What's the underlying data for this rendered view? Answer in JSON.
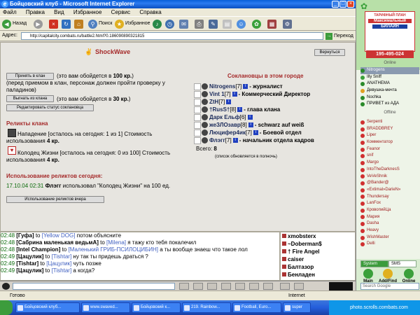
{
  "window": {
    "title": "Бойцовский клуб - Microsoft Internet Explorer"
  },
  "menu": [
    "Файл",
    "Правка",
    "Вид",
    "Избранное",
    "Сервис",
    "Справка"
  ],
  "toolbar": {
    "back_label": "Назад",
    "search_label": "Поиск",
    "favorites_label": "Избранное"
  },
  "address": {
    "label": "Адрес:",
    "url": "http://capitalcity.combats.ru/battle2.html?0.186090890321815",
    "go_label": "Переход"
  },
  "page": {
    "clan_name": "ShockWave",
    "return_button": "Вернуться",
    "accept_button": "Принять в клан",
    "accept_cost": "(это вам обойдется в ",
    "accept_amount": "100 кр.",
    "accept_cost_end": ")",
    "accept_note1": "(перед приемом в клан, персонаж должен пройти проверку у",
    "accept_note2": "паладинов)",
    "kick_button": "Выгнать из клана",
    "kick_cost": "(это вам обойдется в ",
    "kick_amount": "30 кр.",
    "kick_cost_end": ")",
    "edit_status_button": "Редактировать статус соклановца",
    "relics_heading": "Реликты клана",
    "relic1_line1": "Нападение [осталось на сегодня: 1 из 1] Стоимость",
    "relic1_line2_prefix": "использования ",
    "relic1_amount": "4 кр.",
    "relic2_line1": "Колодец Жизни [осталось на сегодня: 0 из 100] Стоимость",
    "relic2_line2_prefix": "использования ",
    "relic2_amount": "4 кр.",
    "usage_heading": "Использование реликтов сегодня:",
    "usage_time": "17.10.04 02:31",
    "usage_nick": "Флэгг",
    "usage_text": " использовал \"Колодец Жизни\" на 100 ед.",
    "usage_yesterday_button": "Использование реликтов вчера",
    "clanmates_heading": "Соклановцы в этом городе",
    "clanmates": [
      {
        "name": "Nitrogens",
        "level": "[7]",
        "role": " - журналист"
      },
      {
        "name": "Vint 1",
        "level": "[7]",
        "role": " - Коммерческий Директор"
      },
      {
        "name": "ZtH",
        "level": "[7]",
        "role": ""
      },
      {
        "name": "†RusS†",
        "level": "[8]",
        "role": " - глава клана"
      },
      {
        "name": "Дарк Ельф",
        "level": "[6]",
        "role": ""
      },
      {
        "name": "жеЗЛОзавр",
        "level": "[8]",
        "role": " - schwarz auf weiß"
      },
      {
        "name": "Люцифер4ик",
        "level": "[7]",
        "role": " - Боевой отдел"
      },
      {
        "name": "Флэгг",
        "level": "[7]",
        "role": " - начальник отдела кадров"
      }
    ],
    "total_label": "Всего: ",
    "total_value": "8",
    "total_note": "(список обновляется в полночь)"
  },
  "chat": [
    {
      "time": "02:48",
      "nick": "[Гуфа]",
      "to": " to ",
      "target": "[Yellow DOG]",
      "text": " потом объясните"
    },
    {
      "time": "02:48",
      "nick": "[Сабрина маленькая ведьмА]",
      "to": " to ",
      "target": "[Milena]",
      "text": " я тажу кто тебя покалечил"
    },
    {
      "time": "02:48",
      "nick": "[Intel Champion]",
      "to": " to ",
      "target": "[Маленький ГРИБ-ПСИЛОЦИБИН]",
      "text": " а ты вообще знаеш что такое лол"
    },
    {
      "time": "02:49",
      "nick": "[Цацулик]",
      "to": " to ",
      "target": "[Tishtar]",
      "text": " ну так ты придешь драться ?"
    },
    {
      "time": "02:49",
      "nick": "[Tishtar]",
      "to": " to ",
      "target": "[Цацулик]",
      "text": " чуть позже"
    },
    {
      "time": "02:49",
      "nick": "[Цацулик]",
      "to": " to ",
      "target": "[Tishtar]",
      "text": " а когда?"
    }
  ],
  "chat_online": [
    "xmobsterx",
    "~Doberman$",
    "† Fire Angel",
    "caiser",
    "Балтазор",
    "Бенладен"
  ],
  "status": {
    "text": "Готово",
    "zone": "Internet"
  },
  "taskbar": {
    "tasks": [
      "Бойцовский клуб...",
      "www.swaved...",
      "Бойцовский к...",
      "219. Rainbow...",
      "Football, Euro...",
      "super"
    ],
    "watermark": "photo.scrolls.combats.com"
  },
  "icq": {
    "promo_title": "ТАРИФНЫЙ ПЛАН",
    "promo_plan": "Максимальный",
    "promo_brand": "БИЛАЙН",
    "phone": "195-495-024",
    "online_label": "Online",
    "offline_label": "Offline",
    "online": [
      "Nitrogens",
      "Illy Sniff",
      "ANATHEMA",
      "Девушка-мечта",
      "Nochka",
      "ПРИВЕТ из АДА"
    ],
    "offline": [
      "Serpenti",
      "BRADDBREY",
      "Liper",
      "Комментатор",
      "Feanor",
      "snif",
      "Margo",
      "IntoTheDarknesS",
      "VeVeShnik",
      "@Bander@",
      "«Extimal»DarieN»",
      "Thundersay",
      "LanFox",
      "КровопийЦа",
      "Мария",
      "Dasha",
      "Heavy",
      "WishMaster",
      "Delli"
    ],
    "tabs": [
      "System",
      "SMS"
    ],
    "buttons": [
      "Main",
      "Add/Find",
      "Online"
    ],
    "search_placeholder": "Search Google"
  },
  "colors": {
    "clan_heading": "#a52a2a",
    "icq_bg": "#b8e0a8",
    "xp_blue": "#0a5fd8"
  }
}
